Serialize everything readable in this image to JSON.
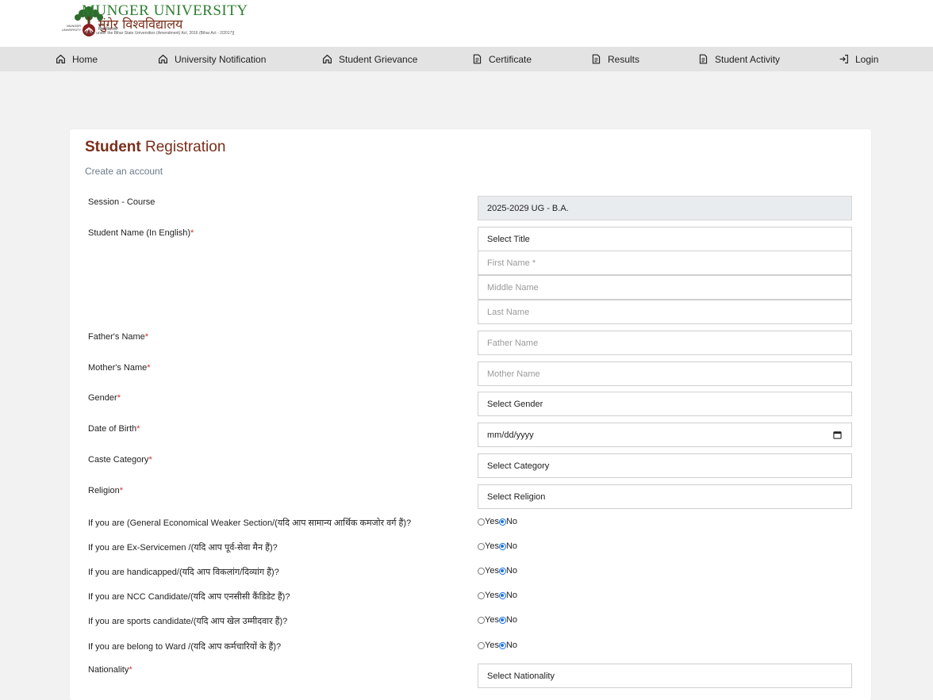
{
  "header": {
    "brand_en": "MUNGER UNIVERSITY",
    "brand_hi": "मुंगेर विश्वविद्यालय",
    "brand_sub": "[Estd. under the Bihar State Universities (Amendment) Act, 2016 (Bihar Act - 2/2017)]",
    "seal_text_left": "MUNGER UNIVERSITY",
    "seal_text_right": "मुंगेर विश्वविद्यालय"
  },
  "nav": {
    "items": [
      {
        "label": "Home",
        "icon": "home-icon"
      },
      {
        "label": "University Notification",
        "icon": "home-icon"
      },
      {
        "label": "Student Grievance",
        "icon": "home-icon"
      },
      {
        "label": "Certificate",
        "icon": "document-icon"
      },
      {
        "label": "Results",
        "icon": "document-icon"
      },
      {
        "label": "Student Activity",
        "icon": "document-icon"
      },
      {
        "label": "Login",
        "icon": "login-icon"
      }
    ]
  },
  "form": {
    "title_bold": "Student",
    "title_rest": " Registration",
    "subtitle": "Create an account",
    "required_mark": "*",
    "session_label": "Session - Course",
    "session_value": "2025-2029 UG - B.A.",
    "name_label": "Student Name (In English)",
    "title_select": "Select Title",
    "first_name_placeholder": "First Name *",
    "middle_name_placeholder": "Middle Name",
    "last_name_placeholder": "Last Name",
    "father_label": "Father's Name",
    "father_placeholder": "Father Name",
    "mother_label": "Mother's Name",
    "mother_placeholder": "Mother Name",
    "gender_label": "Gender",
    "gender_select": "Select Gender",
    "dob_label": "Date of Birth",
    "dob_placeholder": "mm/dd/yyyy",
    "caste_label": "Caste Category",
    "caste_select": "Select Category",
    "religion_label": "Religion",
    "religion_select": "Select Religion",
    "yes_label": "Yes",
    "no_label": "No",
    "questions": [
      {
        "label": "If you are (General Economical Weaker Section/(यदि आप सामान्य आर्थिक कमजोर वर्ग हैं)?",
        "selected": "No"
      },
      {
        "label": "If you are Ex-Servicemen /(यदि आप पूर्व-सेवा मैन हैं)?",
        "selected": "No"
      },
      {
        "label": "If you are handicapped/(यदि आप विकलांग/दिव्यांग हैं)?",
        "selected": "No"
      },
      {
        "label": "If you are NCC Candidate/(यदि आप एनसीसी कैंडिडेट हैं)?",
        "selected": "No"
      },
      {
        "label": "If you are sports candidate/(यदि आप खेल उम्मीदवार हैं)?",
        "selected": "No"
      },
      {
        "label": "If you are belong to Ward /(यदि आप कर्मचारियों के हैं)?",
        "selected": "No"
      }
    ],
    "nationality_label": "Nationality",
    "nationality_select": "Select Nationality"
  },
  "colors": {
    "brand_green": "#2e7d32",
    "brand_maroon": "#7a2e1a",
    "required": "#d32f2f",
    "radio_selected": "#1a73e8"
  }
}
